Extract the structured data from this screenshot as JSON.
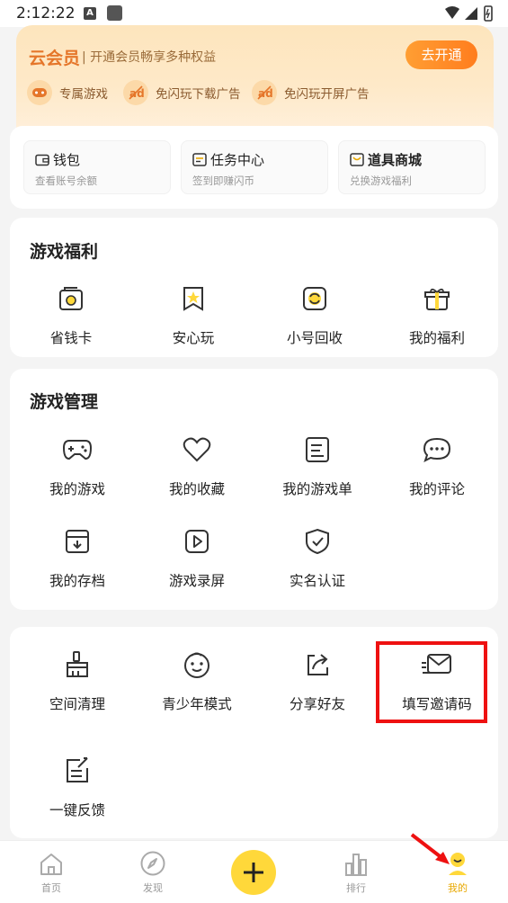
{
  "status_bar": {
    "time": "2:12:22",
    "a_badge": "A"
  },
  "vip": {
    "title": "云会员",
    "desc": "开通会员畅享多种权益",
    "button": "去开通",
    "perks": [
      "专属游戏",
      "免闪玩下载广告",
      "免闪玩开屏广告"
    ]
  },
  "quick": [
    {
      "title": "钱包",
      "sub": "查看账号余额",
      "icon": "wallet-icon"
    },
    {
      "title": "任务中心",
      "sub": "签到即赚闪币",
      "icon": "task-icon"
    },
    {
      "title": "道具商城",
      "sub": "兑换游戏福利",
      "icon": "shop-icon"
    }
  ],
  "welfare": {
    "title": "游戏福利",
    "items": [
      "省钱卡",
      "安心玩",
      "小号回收",
      "我的福利"
    ]
  },
  "manage": {
    "title": "游戏管理",
    "items": [
      "我的游戏",
      "我的收藏",
      "我的游戏单",
      "我的评论",
      "我的存档",
      "游戏录屏",
      "实名认证"
    ]
  },
  "tools": {
    "items": [
      "空间清理",
      "青少年模式",
      "分享好友",
      "填写邀请码",
      "一键反馈"
    ]
  },
  "tabs": [
    "首页",
    "发现",
    "排行",
    "我的"
  ],
  "colors": {
    "accent": "#ffd83a",
    "vip_orange": "#e5762a",
    "highlight": "#ee1111"
  }
}
